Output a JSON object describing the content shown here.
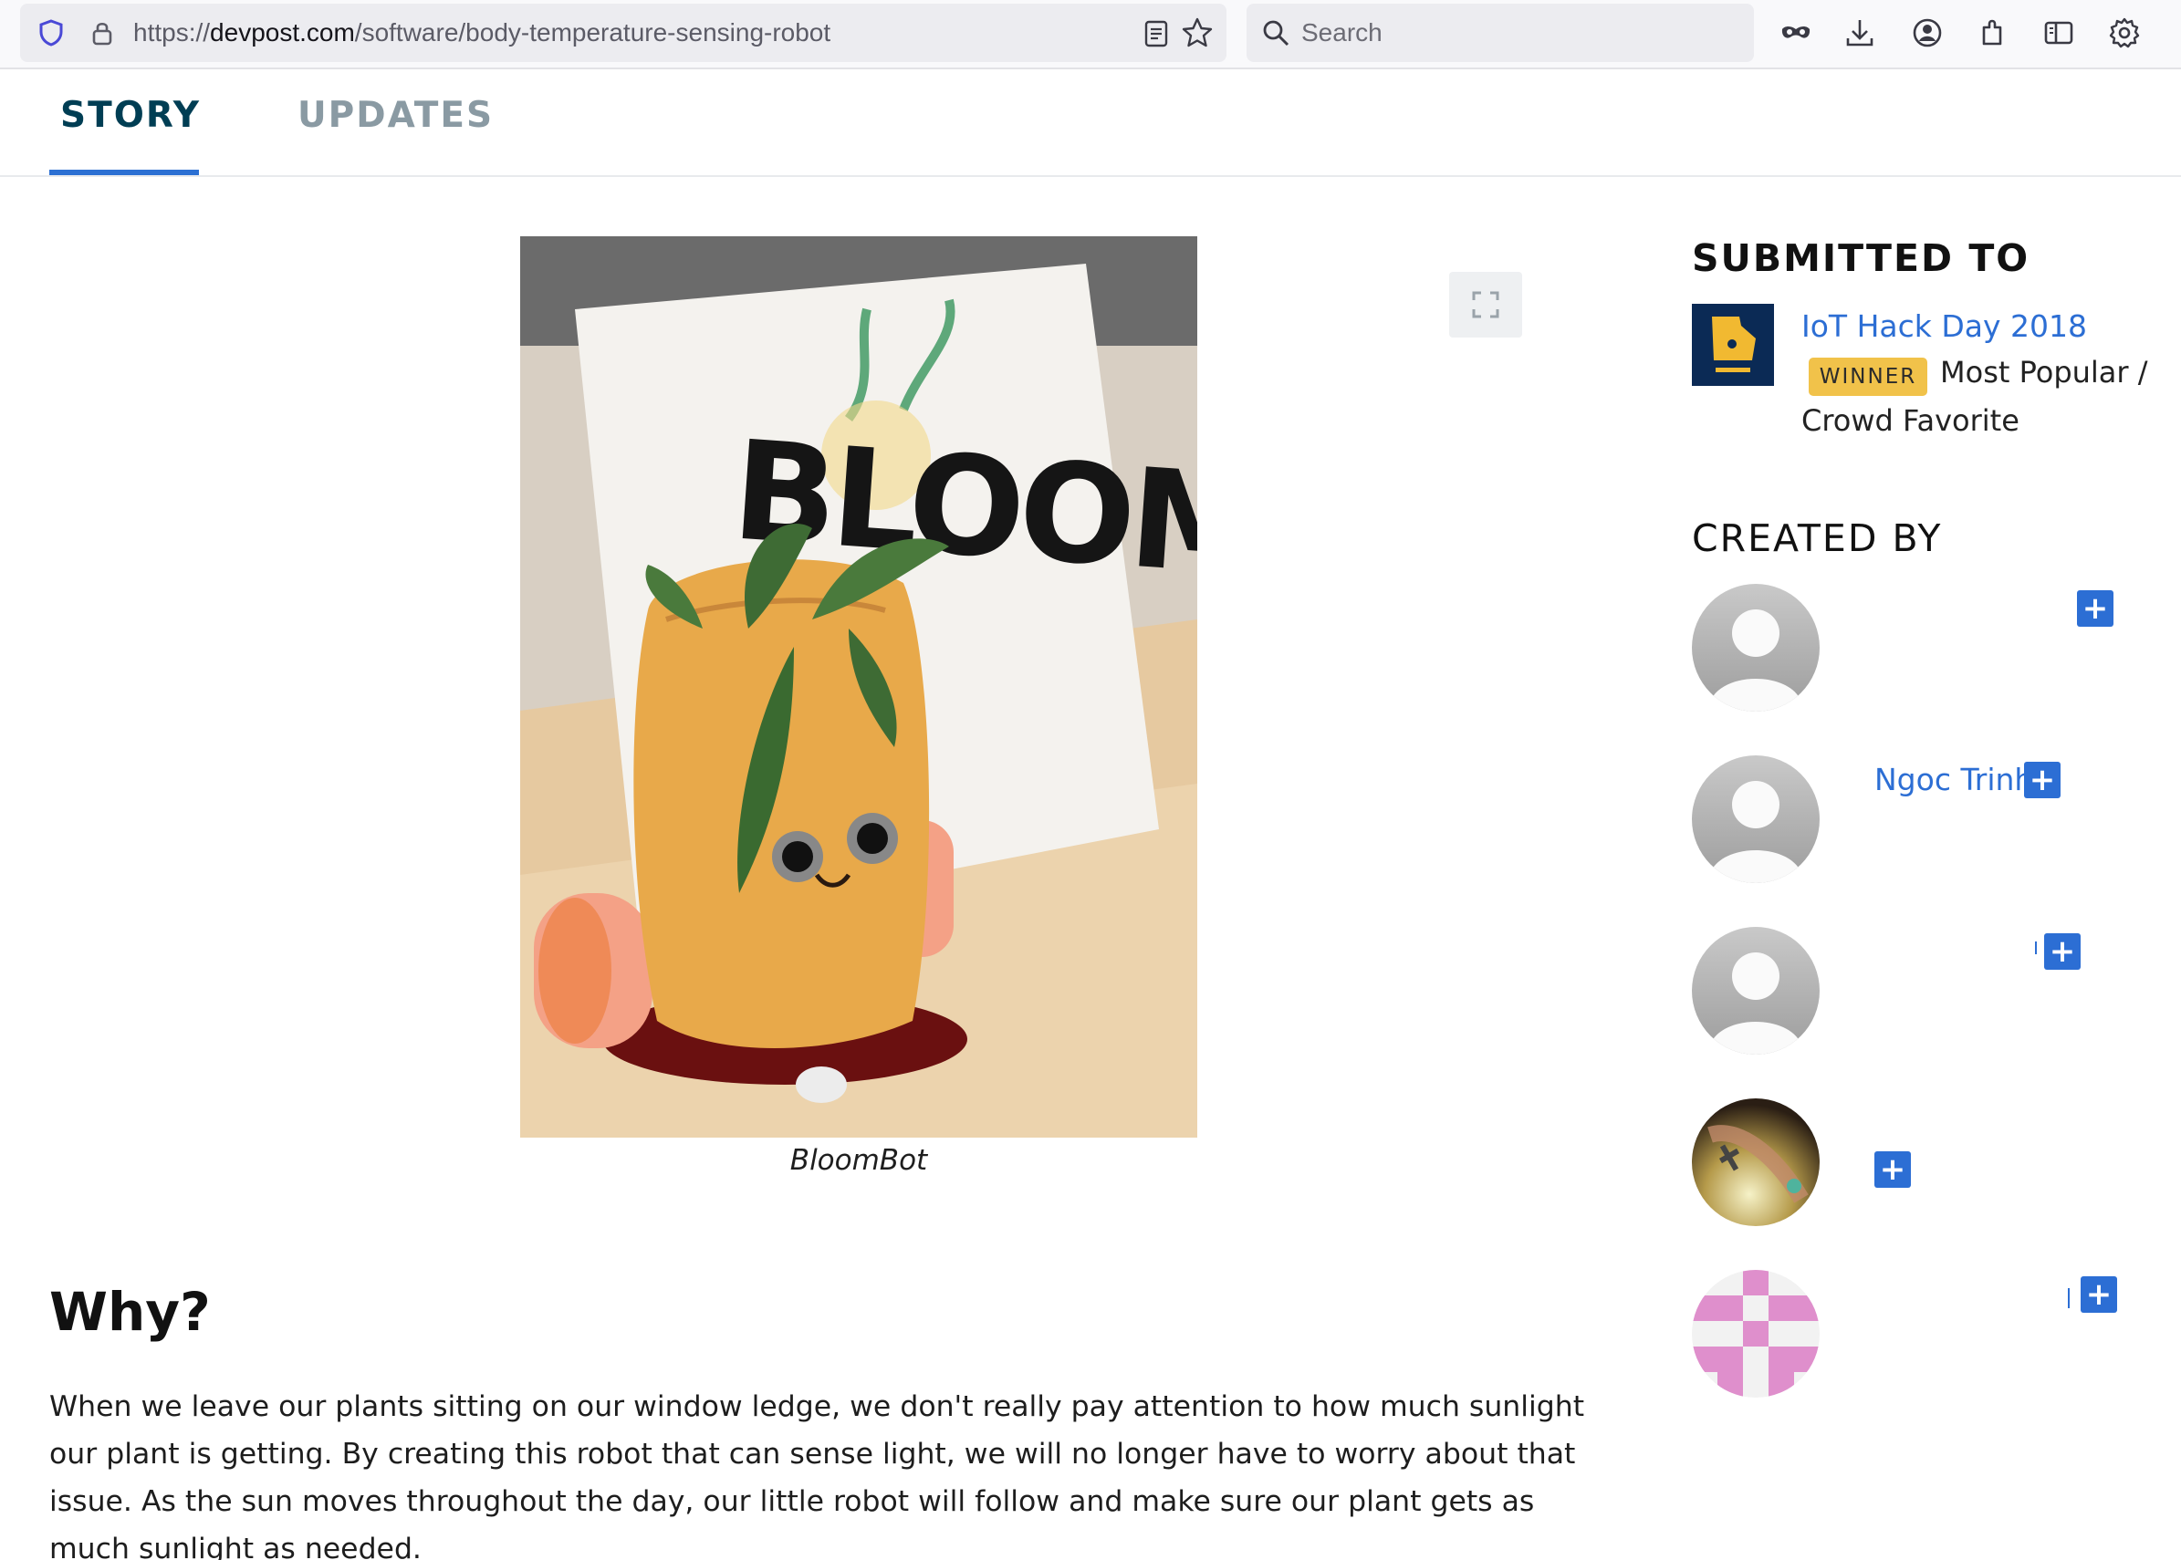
{
  "browser": {
    "url_prefix": "https://",
    "url_host": "devpost.com",
    "url_path": "/software/body-temperature-sensing-robot",
    "search_placeholder": "Search"
  },
  "tabs": [
    {
      "label": "STORY",
      "active": true
    },
    {
      "label": "UPDATES",
      "active": false
    }
  ],
  "gallery": {
    "image_text": "BLOOM BOT",
    "caption": "BloomBot"
  },
  "story": {
    "heading": "Why?",
    "paragraph": "When we leave our plants sitting on our window ledge, we don't really pay attention to how much sunlight our plant is getting. By creating this robot that can sense light, we will no longer have to worry about that issue. As the sun moves throughout the day, our little robot will follow and make sure our plant gets as much sunlight as needed."
  },
  "sidebar": {
    "submitted_heading": "SUBMITTED TO",
    "hackathon": {
      "name": "IoT Hack Day 2018",
      "badge": "WINNER",
      "prize_line1": "Most Popular /",
      "prize_line2": "Crowd Favorite"
    },
    "created_heading": "CREATED BY",
    "members": [
      {
        "name": "",
        "avatar": "default"
      },
      {
        "name": "Ngoc Trinh",
        "avatar": "default"
      },
      {
        "name": "",
        "avatar": "default"
      },
      {
        "name": "",
        "avatar": "photo"
      },
      {
        "name": "",
        "avatar": "identicon"
      }
    ],
    "follow_label": "+"
  },
  "colors": {
    "accent_blue": "#2c6ed4",
    "tab_active": "#003e54",
    "tab_inactive": "#8a9aa3",
    "winner_badge": "#f1c24a"
  }
}
